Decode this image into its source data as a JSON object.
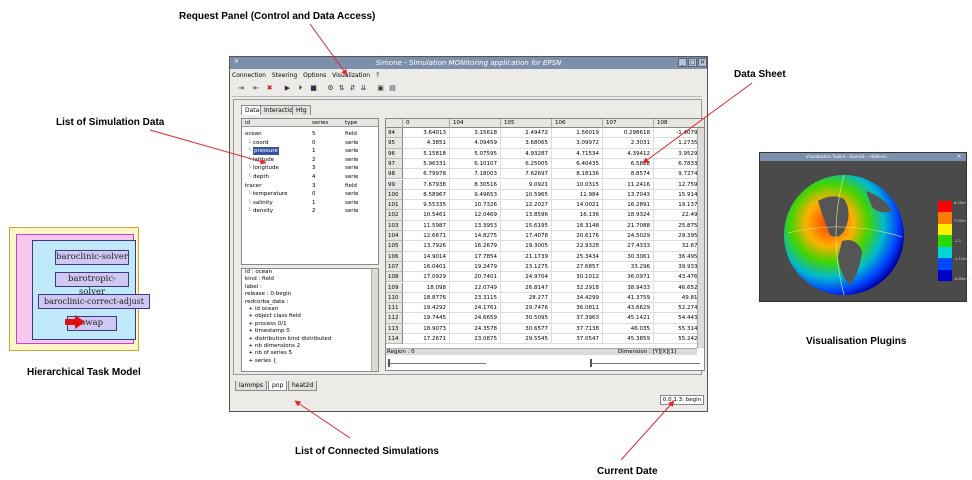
{
  "callouts": {
    "request_panel": "Request Panel (Control and Data Access)",
    "data_sheet": "Data Sheet",
    "list_simulation_data": "List of Simulation Data",
    "hierarchical_task_model": "Hierarchical Task Model",
    "visualisation_plugins": "Visualisation Plugins",
    "list_connected_simulations": "List of Connected Simulations",
    "current_date": "Current Date"
  },
  "main_window": {
    "title": "Simone - SImulation MONitoring application for EPSN",
    "menu": [
      "Connection",
      "Steering",
      "Options",
      "Visualization",
      "?"
    ],
    "tabs": [
      "Data",
      "Interaction",
      "Htg"
    ],
    "active_tab": "Data",
    "data_list": {
      "headers": [
        "id",
        "series",
        "type"
      ],
      "rows": [
        {
          "id": "ocean",
          "series": "5",
          "type": "field",
          "indent": 0,
          "selected": false
        },
        {
          "id": "coord",
          "series": "0",
          "type": "serie",
          "indent": 1,
          "selected": false
        },
        {
          "id": "pressure",
          "series": "1",
          "type": "serie",
          "indent": 1,
          "selected": true
        },
        {
          "id": "latitude",
          "series": "2",
          "type": "serie",
          "indent": 1,
          "selected": false
        },
        {
          "id": "longitude",
          "series": "3",
          "type": "serie",
          "indent": 1,
          "selected": false
        },
        {
          "id": "depth",
          "series": "4",
          "type": "serie",
          "indent": 1,
          "selected": false
        },
        {
          "id": "tracer",
          "series": "3",
          "type": "field",
          "indent": 0,
          "selected": false
        },
        {
          "id": "temperature",
          "series": "0",
          "type": "serie",
          "indent": 1,
          "selected": false
        },
        {
          "id": "salinity",
          "series": "1",
          "type": "serie",
          "indent": 1,
          "selected": false
        },
        {
          "id": "density",
          "series": "2",
          "type": "serie",
          "indent": 1,
          "selected": false
        }
      ]
    },
    "info_panel": [
      "id : ocean",
      "kind : field",
      "label :",
      "release : 0:begin",
      "redcorba_data :",
      "  + id ocean",
      "  + object class field",
      "  + process 0/1",
      "  + timestamp 0",
      "  + distribution kind distributed",
      "  + nb dimensions 2",
      "  + nb of series 5",
      "  + series {"
    ],
    "simulation_tabs": [
      "lammps",
      "pnp",
      "heat2d"
    ],
    "active_simulation": "pnp",
    "sheet": {
      "columns": [
        "0",
        "104",
        "105",
        "106",
        "107",
        "108"
      ],
      "rows": [
        {
          "n": "94",
          "v": [
            "3.64013",
            "3.15618",
            "2.49472",
            "1.56019",
            "0.298618",
            "-1.40799"
          ]
        },
        {
          "n": "95",
          "v": [
            "4.3851",
            "4.09459",
            "3.68065",
            "3.09972",
            "2.3031",
            "1.27356"
          ]
        },
        {
          "n": "96",
          "v": [
            "5.15818",
            "5.07595",
            "4.93287",
            "4.71534",
            "4.39412",
            "3.95291"
          ]
        },
        {
          "n": "97",
          "v": [
            "5.96331",
            "6.10107",
            "6.25005",
            "6.40435",
            "6.5828",
            "6.78333"
          ]
        },
        {
          "n": "98",
          "v": [
            "6.79978",
            "7.18003",
            "7.62697",
            "8.18136",
            "8.8574",
            "9.72747"
          ]
        },
        {
          "n": "99",
          "v": [
            "7.67938",
            "8.30516",
            "9.0921",
            "10.0315",
            "11.2416",
            "12.7597"
          ]
        },
        {
          "n": "100",
          "v": [
            "8.58967",
            "9.49653",
            "10.5965",
            "11.984",
            "13.7043",
            "15.9146"
          ]
        },
        {
          "n": "101",
          "v": [
            "9.55335",
            "10.7326",
            "12.2027",
            "14.0021",
            "16.2891",
            "19.1375"
          ]
        },
        {
          "n": "102",
          "v": [
            "10.5461",
            "12.0469",
            "13.8596",
            "16.136",
            "18.9324",
            "22.492"
          ]
        },
        {
          "n": "103",
          "v": [
            "11.5987",
            "13.3953",
            "15.6195",
            "18.3148",
            "21.7088",
            "25.8751"
          ]
        },
        {
          "n": "104",
          "v": [
            "12.6671",
            "14.8275",
            "17.4078",
            "20.6176",
            "24.5029",
            "29.3959"
          ]
        },
        {
          "n": "105",
          "v": [
            "13.7926",
            "16.2679",
            "19.3005",
            "22.9328",
            "27.4333",
            "32.874"
          ]
        },
        {
          "n": "106",
          "v": [
            "14.9014",
            "17.7854",
            "21.1739",
            "25.3434",
            "30.3061",
            "36.4952"
          ]
        },
        {
          "n": "107",
          "v": [
            "16.0401",
            "19.2479",
            "23.1275",
            "27.6857",
            "33.296",
            "39.9334"
          ]
        },
        {
          "n": "108",
          "v": [
            "17.0929",
            "20.7401",
            "24.9704",
            "30.1012",
            "36.0971",
            "43.4769"
          ]
        },
        {
          "n": "109",
          "v": [
            "18.098",
            "22.0749",
            "26.8147",
            "32.2918",
            "38.9433",
            "46.6521"
          ]
        },
        {
          "n": "110",
          "v": [
            "18.8776",
            "23.3115",
            "28.277",
            "34.4299",
            "41.3759",
            "49.819"
          ]
        },
        {
          "n": "111",
          "v": [
            "19.4292",
            "24.1761",
            "29.7476",
            "36.0811",
            "43.6629",
            "52.2744"
          ]
        },
        {
          "n": "112",
          "v": [
            "19.7445",
            "24.6659",
            "30.5095",
            "37.3963",
            "45.1421",
            "54.4434"
          ]
        },
        {
          "n": "113",
          "v": [
            "18.9073",
            "24.3578",
            "30.6577",
            "37.7138",
            "46.035",
            "55.3146"
          ]
        },
        {
          "n": "114",
          "v": [
            "17.2671",
            "23.0875",
            "29.5545",
            "37.0547",
            "45.3859",
            "55.2426"
          ]
        }
      ]
    },
    "region_label": "Region : 0",
    "dimension_label": "Dimension : [Y][X][1]",
    "current_date": "0.0.1.3: begin"
  },
  "task_model": {
    "tasks": [
      "baroclinic-solver",
      "barotropic-solver",
      "baroclinic-correct-adjust",
      "swap"
    ]
  },
  "vis_window": {
    "title": "Visualisation Toolkit - OpenGL - vtkRend...",
    "legend_ticks": [
      "8.10e+0",
      "7.02e+0",
      "-2.2",
      "-1.11e+0",
      "-8.89e+0"
    ],
    "colorbar_colors": [
      "#ff0000",
      "#ff7a00",
      "#ffee00",
      "#2ad900",
      "#00d6d6",
      "#0048ff",
      "#0000c8"
    ]
  },
  "colors": {
    "accent_arrow": "#e0282c",
    "titlebar": "#7c90ab",
    "selection": "#3753a4"
  }
}
